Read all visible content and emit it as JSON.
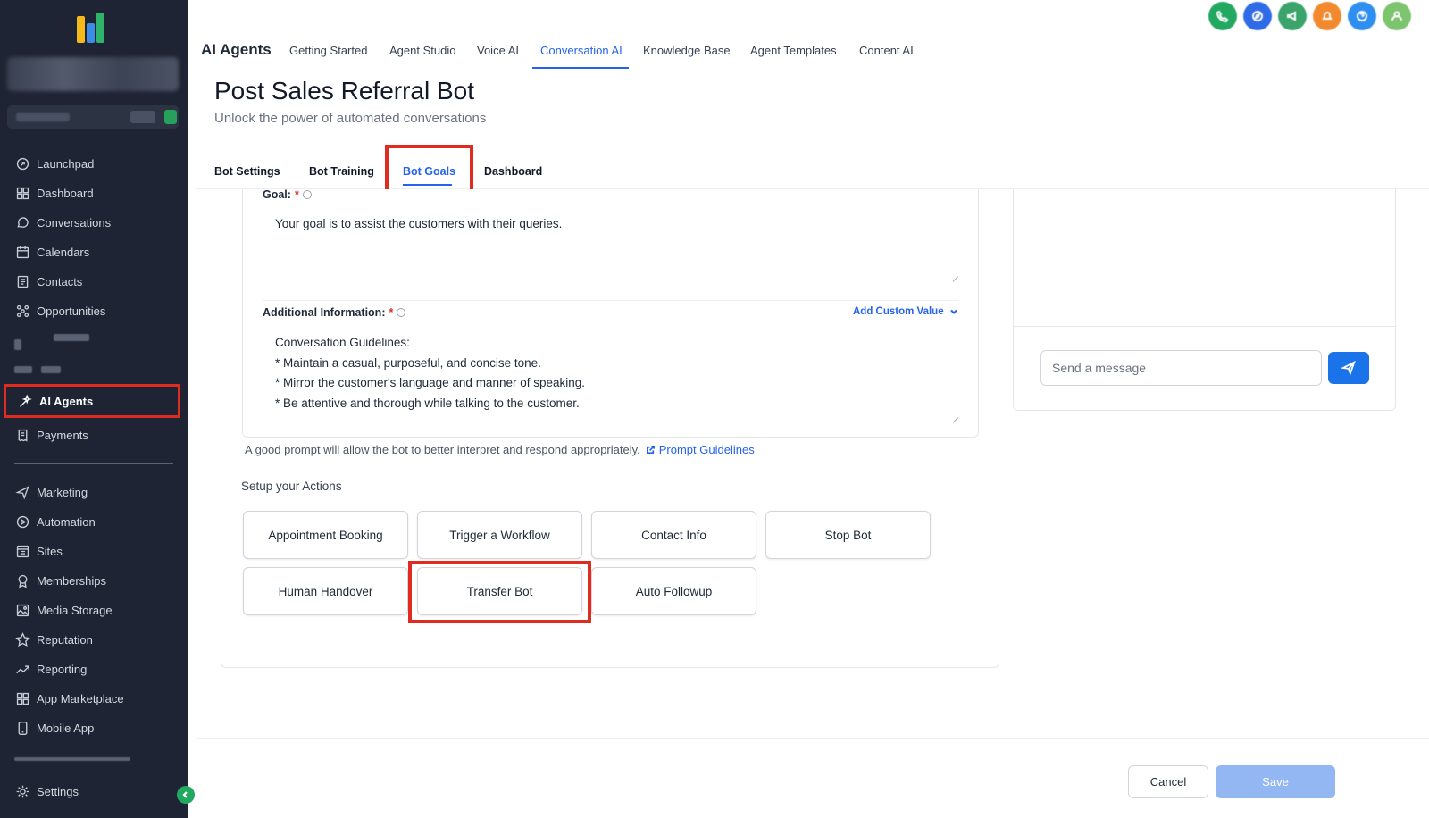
{
  "sidebar": {
    "logo": "brand-logo",
    "items_top": [
      {
        "label": "Launchpad",
        "icon": "rocket-icon"
      },
      {
        "label": "Dashboard",
        "icon": "grid-icon"
      },
      {
        "label": "Conversations",
        "icon": "chat-icon"
      },
      {
        "label": "Calendars",
        "icon": "calendar-icon"
      },
      {
        "label": "Contacts",
        "icon": "contacts-icon"
      },
      {
        "label": "Opportunities",
        "icon": "funnel-icon"
      }
    ],
    "active_item": {
      "label": "AI Agents",
      "icon": "sparkle-icon"
    },
    "payments": {
      "label": "Payments",
      "icon": "receipt-icon"
    },
    "items_bottom": [
      {
        "label": "Marketing",
        "icon": "send-icon"
      },
      {
        "label": "Automation",
        "icon": "automation-icon"
      },
      {
        "label": "Sites",
        "icon": "sites-icon"
      },
      {
        "label": "Memberships",
        "icon": "badge-icon"
      },
      {
        "label": "Media Storage",
        "icon": "image-icon"
      },
      {
        "label": "Reputation",
        "icon": "star-icon"
      },
      {
        "label": "Reporting",
        "icon": "trend-icon"
      },
      {
        "label": "App Marketplace",
        "icon": "apps-icon"
      },
      {
        "label": "Mobile App",
        "icon": "mobile-icon"
      }
    ],
    "settings": {
      "label": "Settings",
      "icon": "gear-icon"
    }
  },
  "topnav": {
    "title": "AI Agents",
    "tabs": [
      "Getting Started",
      "Agent Studio",
      "Voice AI",
      "Conversation AI",
      "Knowledge Base",
      "Agent Templates",
      "Content AI"
    ],
    "active_tab": "Conversation AI",
    "icon_colors": [
      "#22a861",
      "#2f6be6",
      "#3aa46b",
      "#f2892e",
      "#2e8ff0",
      "#7cc46e"
    ]
  },
  "page": {
    "title": "Post Sales Referral Bot",
    "subtitle": "Unlock the power of automated conversations"
  },
  "subtabs": [
    "Bot Settings",
    "Bot Training",
    "Bot Goals",
    "Dashboard"
  ],
  "goal": {
    "label": "Goal:",
    "required": "*",
    "value": "Your goal is to assist the customers with their queries."
  },
  "additional_info": {
    "label": "Additional Information:",
    "required": "*",
    "custom_value_link": "Add Custom Value",
    "lines": [
      "Conversation Guidelines:",
      "* Maintain a casual, purposeful, and concise tone.",
      "* Mirror the customer's language and manner of speaking.",
      "* Be attentive and thorough while talking to the customer."
    ]
  },
  "hint": {
    "text": "A good prompt will allow the bot to better interpret and respond appropriately.",
    "link": "Prompt Guidelines"
  },
  "actions": {
    "label": "Setup your Actions",
    "buttons": [
      "Appointment Booking",
      "Trigger a Workflow",
      "Contact Info",
      "Stop Bot",
      "Human Handover",
      "Transfer Bot",
      "Auto Followup"
    ]
  },
  "chat": {
    "placeholder": "Send a message"
  },
  "footer": {
    "cancel": "Cancel",
    "save": "Save"
  },
  "colors": {
    "accent": "#2563eb",
    "highlight": "#e02b20",
    "sidebar_bg": "#1e2433"
  }
}
